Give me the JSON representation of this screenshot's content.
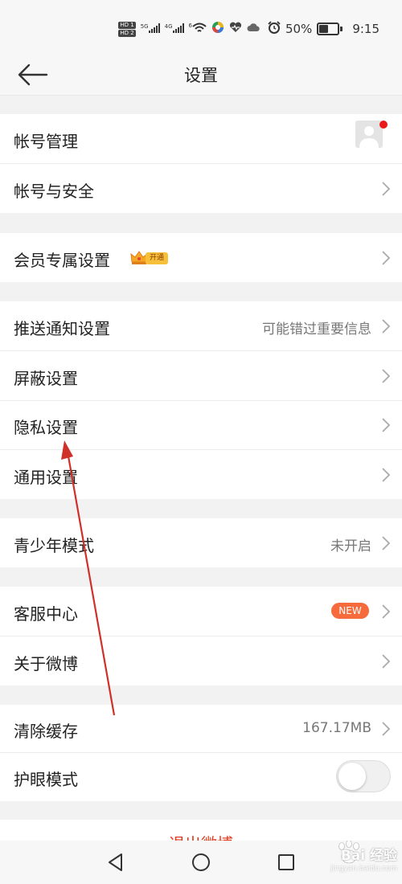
{
  "status_bar": {
    "hd1": "HD 1",
    "hd2": "HD 2",
    "sig1_net": "5G",
    "sig2_net": "4G",
    "wifi_net": "6",
    "battery_percent": "50%",
    "time": "9:15",
    "icons": [
      "signal-icon",
      "signal-icon",
      "wifi-icon",
      "app-icon",
      "heart-icon",
      "cloud-icon",
      "alarm-icon",
      "battery-icon"
    ]
  },
  "header": {
    "title": "设置",
    "back_icon": "arrow-left-icon"
  },
  "groups": [
    {
      "items": [
        {
          "label": "帐号管理",
          "trailing": "avatar"
        },
        {
          "label": "帐号与安全",
          "trailing": "chevron"
        }
      ]
    },
    {
      "items": [
        {
          "label": "会员专属设置",
          "badge": "开通",
          "badge_icon": "crown-icon",
          "trailing": "chevron"
        }
      ]
    },
    {
      "items": [
        {
          "label": "推送通知设置",
          "value": "可能错过重要信息",
          "trailing": "chevron"
        },
        {
          "label": "屏蔽设置",
          "trailing": "chevron"
        },
        {
          "label": "隐私设置",
          "trailing": "chevron"
        },
        {
          "label": "通用设置",
          "trailing": "chevron"
        }
      ]
    },
    {
      "items": [
        {
          "label": "青少年模式",
          "value": "未开启",
          "trailing": "chevron"
        }
      ]
    },
    {
      "items": [
        {
          "label": "客服中心",
          "badge": "NEW",
          "trailing": "chevron"
        },
        {
          "label": "关于微博",
          "trailing": "chevron"
        }
      ]
    },
    {
      "items": [
        {
          "label": "清除缓存",
          "value": "167.17MB",
          "trailing": "chevron"
        },
        {
          "label": "护眼模式",
          "toggle_on": false
        }
      ]
    }
  ],
  "logout_label": "退出微博",
  "colors": {
    "accent_red": "#e03a1e",
    "badge_new": "#f56b3c",
    "badge_vip": "#f7c03a",
    "background": "#f2f2f2",
    "annotation_arrow": "#d0302a"
  },
  "nav_keys": [
    "back-triangle-icon",
    "home-circle-icon",
    "recents-square-icon"
  ],
  "watermark": {
    "line1": "Bai 经验",
    "line2": "jingyan.baidu.com"
  }
}
